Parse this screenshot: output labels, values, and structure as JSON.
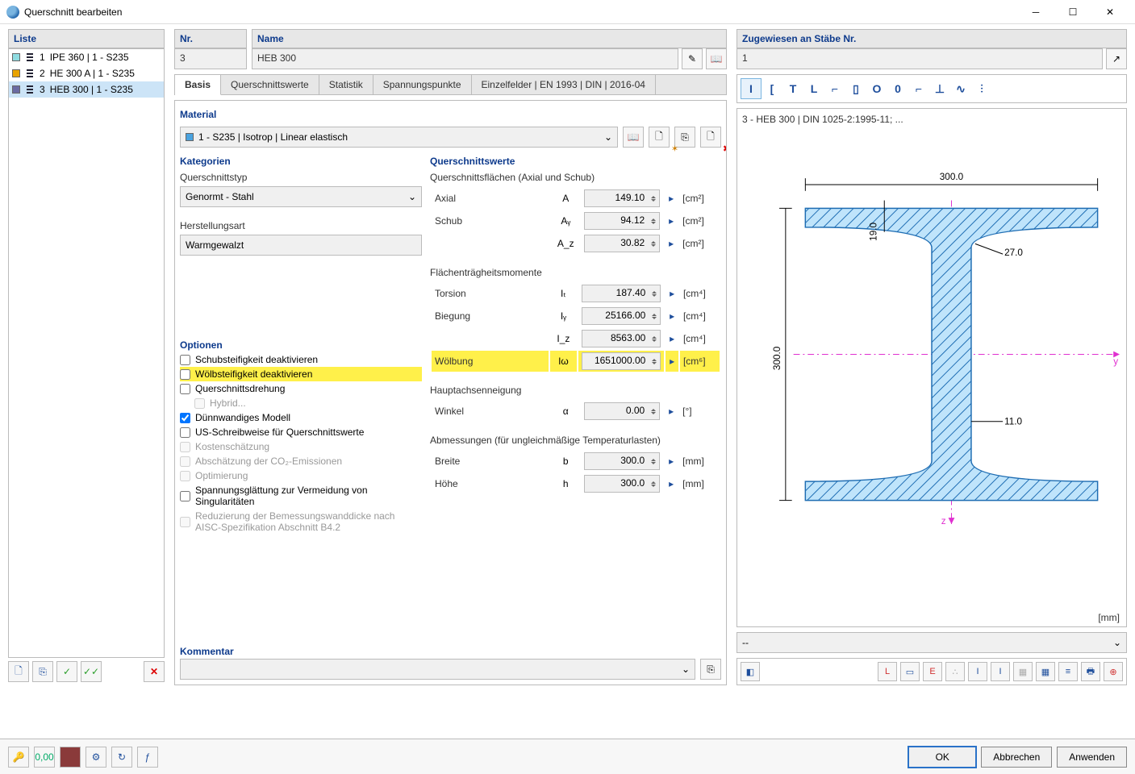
{
  "window": {
    "title": "Querschnitt bearbeiten"
  },
  "list": {
    "header": "Liste",
    "items": [
      {
        "num": "1",
        "label": "IPE 360 | 1 - S235",
        "color": "#8fdce1"
      },
      {
        "num": "2",
        "label": "HE 300 A | 1 - S235",
        "color": "#e8a300"
      },
      {
        "num": "3",
        "label": "HEB 300 | 1 - S235",
        "color": "#6b6ba3"
      }
    ],
    "selected_index": 2
  },
  "nr": {
    "header": "Nr.",
    "value": "3"
  },
  "name": {
    "header": "Name",
    "value": "HEB 300"
  },
  "assigned": {
    "header": "Zugewiesen an Stäbe Nr.",
    "value": "1"
  },
  "tabs": [
    "Basis",
    "Querschnittswerte",
    "Statistik",
    "Spannungspunkte",
    "Einzelfelder | EN 1993 | DIN | 2016-04"
  ],
  "active_tab": 0,
  "material": {
    "header": "Material",
    "value": "1 - S235 | Isotrop | Linear elastisch"
  },
  "categories": {
    "header": "Kategorien",
    "type_label": "Querschnittstyp",
    "type_value": "Genormt - Stahl",
    "mfg_label": "Herstellungsart",
    "mfg_value": "Warmgewalzt"
  },
  "options": {
    "header": "Optionen",
    "items": [
      {
        "label": "Schubsteifigkeit deaktivieren",
        "checked": false,
        "disabled": false,
        "hl": false
      },
      {
        "label": "Wölbsteifigkeit deaktivieren",
        "checked": false,
        "disabled": false,
        "hl": true
      },
      {
        "label": "Querschnittsdrehung",
        "checked": false,
        "disabled": false,
        "hl": false
      },
      {
        "label": "Hybrid...",
        "checked": false,
        "disabled": true,
        "hl": false,
        "indent": true
      },
      {
        "label": "Dünnwandiges Modell",
        "checked": true,
        "disabled": false,
        "hl": false
      },
      {
        "label": "US-Schreibweise für Querschnittswerte",
        "checked": false,
        "disabled": false,
        "hl": false
      },
      {
        "label": "Kostenschätzung",
        "checked": false,
        "disabled": true,
        "hl": false
      },
      {
        "label": "Abschätzung der CO₂-Emissionen",
        "checked": false,
        "disabled": true,
        "hl": false
      },
      {
        "label": "Optimierung",
        "checked": false,
        "disabled": true,
        "hl": false
      },
      {
        "label": "Spannungsglättung zur Vermeidung von Singularitäten",
        "checked": false,
        "disabled": false,
        "hl": false
      },
      {
        "label": "Reduzierung der Bemessungswanddicke nach AISC-Spezifikation Abschnitt B4.2",
        "checked": false,
        "disabled": true,
        "hl": false
      }
    ]
  },
  "values": {
    "header": "Querschnittswerte",
    "areas_header": "Querschnittsflächen (Axial und Schub)",
    "rows_areas": [
      {
        "label": "Axial",
        "sym": "A",
        "val": "149.10",
        "unit": "[cm²]"
      },
      {
        "label": "Schub",
        "sym": "Aᵧ",
        "val": "94.12",
        "unit": "[cm²]"
      },
      {
        "label": "",
        "sym": "A_z",
        "val": "30.82",
        "unit": "[cm²]"
      }
    ],
    "inertia_header": "Flächenträgheitsmomente",
    "rows_inertia": [
      {
        "label": "Torsion",
        "sym": "Iₜ",
        "val": "187.40",
        "unit": "[cm⁴]"
      },
      {
        "label": "Biegung",
        "sym": "Iᵧ",
        "val": "25166.00",
        "unit": "[cm⁴]"
      },
      {
        "label": "",
        "sym": "I_z",
        "val": "8563.00",
        "unit": "[cm⁴]"
      },
      {
        "label": "Wölbung",
        "sym": "Iω",
        "val": "1651000.00",
        "unit": "[cm⁶]",
        "hl": true
      }
    ],
    "axis_header": "Hauptachsenneigung",
    "rows_axis": [
      {
        "label": "Winkel",
        "sym": "α",
        "val": "0.00",
        "unit": "[°]"
      }
    ],
    "dims_header": "Abmessungen (für ungleichmäßige Temperaturlasten)",
    "rows_dims": [
      {
        "label": "Breite",
        "sym": "b",
        "val": "300.0",
        "unit": "[mm]"
      },
      {
        "label": "Höhe",
        "sym": "h",
        "val": "300.0",
        "unit": "[mm]"
      }
    ]
  },
  "comment": {
    "header": "Kommentar",
    "value": ""
  },
  "preview": {
    "title": "3 - HEB 300 | DIN 1025-2:1995-11; ...",
    "unit": "[mm]",
    "dropdown": "--",
    "dims": {
      "width": "300.0",
      "height": "300.0",
      "flange": "19.0",
      "web": "11.0",
      "radius": "27.0"
    }
  },
  "shape_icons": [
    "I",
    "[",
    "T",
    "L",
    "⌐",
    "▯",
    "O",
    "0",
    "⌐",
    "⊥",
    "∿",
    "⫶"
  ],
  "buttons": {
    "ok": "OK",
    "cancel": "Abbrechen",
    "apply": "Anwenden"
  }
}
